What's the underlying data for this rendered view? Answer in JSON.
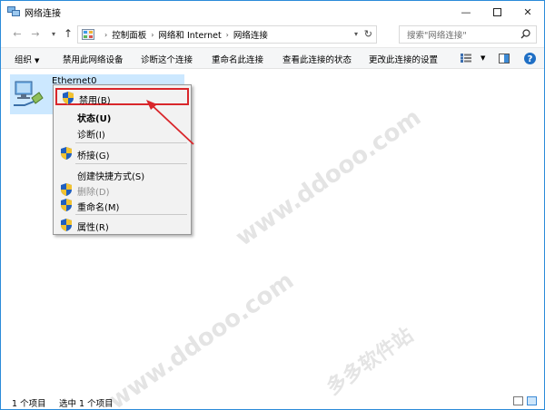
{
  "window": {
    "title": "网络连接",
    "minimize_glyph": "—",
    "close_glyph": "✕"
  },
  "address_bar": {
    "crumbs": [
      "控制面板",
      "网络和 Internet",
      "网络连接"
    ],
    "search_placeholder": "搜索\"网络连接\""
  },
  "command_bar": {
    "items": [
      "组织",
      "禁用此网络设备",
      "诊断这个连接",
      "重命名此连接",
      "查看此连接的状态",
      "更改此连接的设置"
    ]
  },
  "content": {
    "item_name": "Ethernet0"
  },
  "context_menu": {
    "items": [
      {
        "label": "禁用(B)",
        "shield": true,
        "highlighted": true
      },
      {
        "label": "状态(U)",
        "bold": true
      },
      {
        "label": "诊断(I)"
      },
      {
        "label": "桥接(G)",
        "shield": true
      },
      {
        "label": "创建快捷方式(S)"
      },
      {
        "label": "删除(D)",
        "shield": true,
        "disabled": true
      },
      {
        "label": "重命名(M)",
        "shield": true
      },
      {
        "label": "属性(R)",
        "shield": true
      }
    ]
  },
  "watermark": {
    "lines": [
      "www.ddooo.com",
      "多多软件站"
    ]
  },
  "status_bar": {
    "count": "1 个项目",
    "selected": "选中 1 个项目"
  },
  "colors": {
    "accent": "#2b8bd9",
    "selection": "#cce8ff",
    "highlight_box": "#d9262b",
    "command_bar_bg": "#f5f6f7"
  }
}
